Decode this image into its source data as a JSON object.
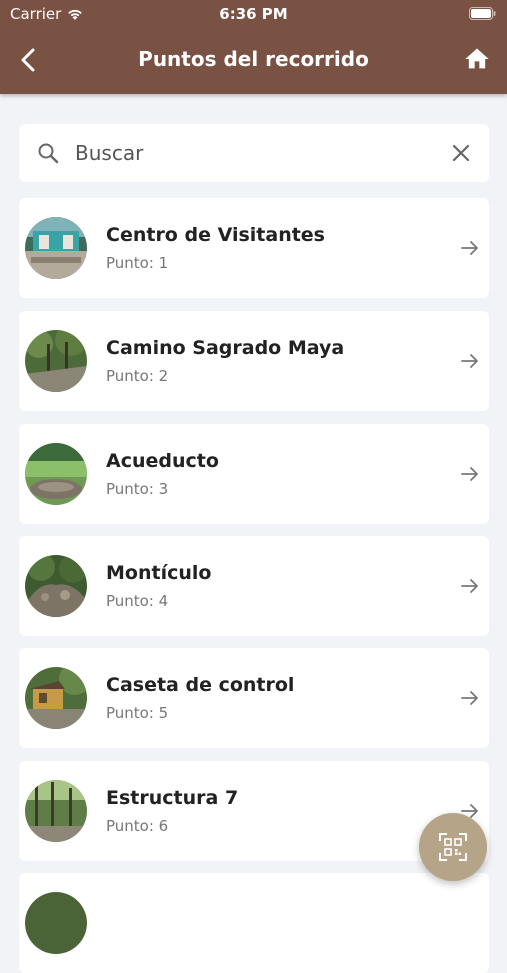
{
  "status_bar": {
    "carrier": "Carrier",
    "time": "6:36 PM"
  },
  "header": {
    "title": "Puntos del recorrido"
  },
  "search": {
    "placeholder": "Buscar",
    "value": ""
  },
  "points": [
    {
      "name": "Centro de Visitantes",
      "subtitle": "Punto: 1"
    },
    {
      "name": "Camino Sagrado Maya",
      "subtitle": "Punto: 2"
    },
    {
      "name": "Acueducto",
      "subtitle": "Punto: 3"
    },
    {
      "name": "Montículo",
      "subtitle": "Punto: 4"
    },
    {
      "name": "Caseta de control",
      "subtitle": "Punto: 5"
    },
    {
      "name": "Estructura 7",
      "subtitle": "Punto: 6"
    }
  ],
  "icons": {
    "back": "chevron-left-icon",
    "home": "home-icon",
    "search": "search-icon",
    "clear": "close-icon",
    "row_arrow": "arrow-right-icon",
    "fab": "qr-scan-icon"
  },
  "colors": {
    "header": "#7a5244",
    "background": "#f2f3f7",
    "fab": "#b5a487"
  }
}
